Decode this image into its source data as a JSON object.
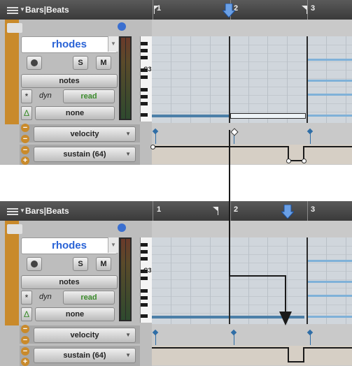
{
  "panels": [
    {
      "ruler_title": "Bars|Beats",
      "bar_labels": [
        "1",
        "2",
        "3"
      ],
      "track_name": "rhodes",
      "solo_label": "S",
      "mute_label": "M",
      "view_label": "notes",
      "dyn_label": "dyn",
      "automation_mode": "read",
      "group_label": "none",
      "c3_label": "C3",
      "lanes": [
        {
          "label": "velocity"
        },
        {
          "label": "sustain (64)"
        }
      ]
    },
    {
      "ruler_title": "Bars|Beats",
      "bar_labels": [
        "1",
        "2",
        "3"
      ],
      "track_name": "rhodes",
      "solo_label": "S",
      "mute_label": "M",
      "view_label": "notes",
      "dyn_label": "dyn",
      "automation_mode": "read",
      "group_label": "none",
      "c3_label": "C3",
      "lanes": [
        {
          "label": "velocity"
        },
        {
          "label": "sustain (64)"
        }
      ]
    }
  ],
  "colors": {
    "track_accent": "#c98a2b",
    "track_name": "#2a63d6",
    "read_mode": "#3c8c2c",
    "note": "#7fb1d8",
    "controller": "#2f6ea6"
  }
}
